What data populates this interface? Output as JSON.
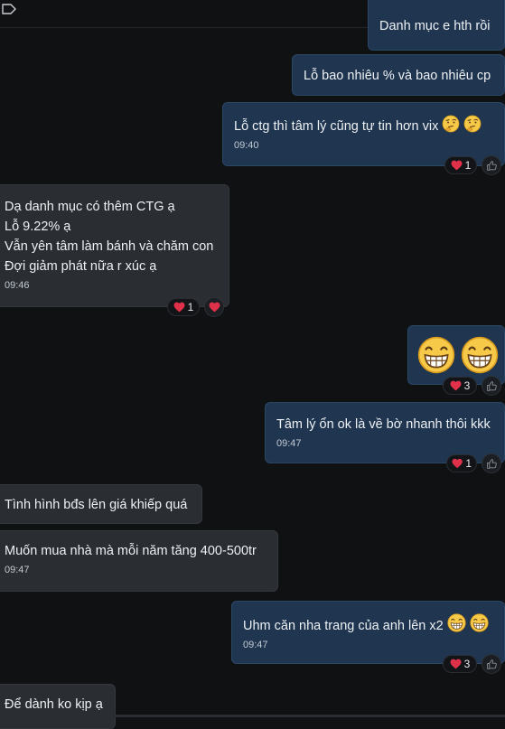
{
  "messages": {
    "m1": {
      "text": "Danh mục e hth rồi"
    },
    "m2": {
      "text": "Lỗ bao nhiêu % và bao nhiêu cp"
    },
    "m3": {
      "text": "Lỗ ctg thì tâm lý cũng tự tin hơn vix",
      "time": "09:40",
      "reaction_count": "1"
    },
    "m4": {
      "lines": [
        "Dạ danh mục có thêm CTG ạ",
        "Lỗ 9.22% ạ",
        "Vẫn yên tâm làm bánh và chăm con",
        "Đợi giảm phát nữa r xúc ạ"
      ],
      "time": "09:46",
      "reaction_count": "1"
    },
    "m5": {
      "reaction_count": "3"
    },
    "m6": {
      "text": "Tâm lý ổn ok là về bờ nhanh thôi kkk",
      "time": "09:47",
      "reaction_count": "1"
    },
    "m7": {
      "text": "Tình hình bđs lên giá khiếp quá"
    },
    "m8": {
      "text": "Muốn mua nhà mà mỗi năm tăng 400-500tr",
      "time": "09:47"
    },
    "m9": {
      "text": "Uhm căn nha trang của anh lên x2",
      "time": "09:47",
      "reaction_count": "3"
    },
    "m10": {
      "text": "Để dành ko kịp ạ"
    }
  },
  "colors": {
    "outgoing_bubble": "#1f3550",
    "incoming_bubble": "#2a2d31",
    "heart": "#e0314b",
    "background": "#0f1113"
  },
  "icons": [
    "tag-icon",
    "heart-icon",
    "thumbs-up-icon",
    "thinking-face-emoji",
    "grinning-face-emoji"
  ]
}
